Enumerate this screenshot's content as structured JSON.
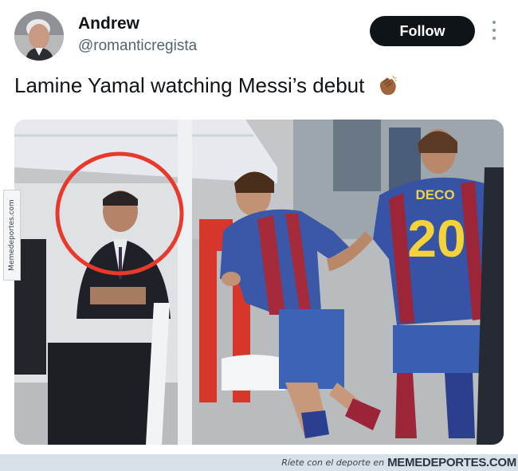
{
  "tweet": {
    "author": {
      "display_name": "Andrew",
      "handle": "@romanticregista"
    },
    "follow_label": "Follow",
    "text": "Lamine Yamal watching Messi’s debut",
    "emoji_icon": "clapping-hands-icon",
    "more_icon": "more-vertical-icon"
  },
  "media": {
    "jersey_name": "DECO",
    "jersey_number": "20",
    "highlight_color": "#e8392b"
  },
  "watermark": {
    "side_text": "Memedeportes.com",
    "footer_text": "Ríete con el deporte en",
    "footer_brand": "MEMEDEPORTES.COM"
  }
}
